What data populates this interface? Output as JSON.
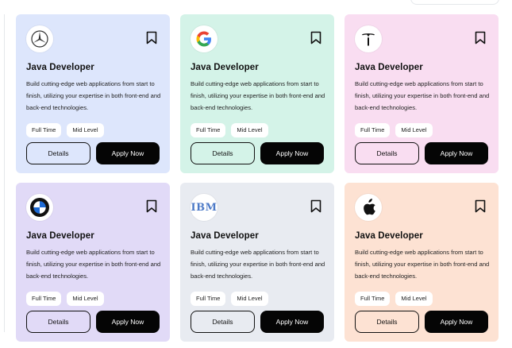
{
  "cards": [
    {
      "company_icon": "mercedes-logo",
      "title": "Java Developer",
      "description": "Build cutting-edge web applications from start to finish, utilizing your expertise in both front-end and back-end technologies.",
      "tags": [
        "Full Time",
        "Mid Level"
      ],
      "details_label": "Details",
      "apply_label": "Apply Now",
      "bg_color": "#dde6fc"
    },
    {
      "company_icon": "google-logo",
      "title": "Java Developer",
      "description": "Build cutting-edge web applications from start to finish, utilizing your expertise in both front-end and back-end technologies.",
      "tags": [
        "Full Time",
        "Mid Level"
      ],
      "details_label": "Details",
      "apply_label": "Apply Now",
      "bg_color": "#d4f3e8"
    },
    {
      "company_icon": "tesla-logo",
      "title": "Java Developer",
      "description": "Build cutting-edge web applications from start to finish, utilizing your expertise in both front-end and back-end technologies.",
      "tags": [
        "Full Time",
        "Mid Level"
      ],
      "details_label": "Details",
      "apply_label": "Apply Now",
      "bg_color": "#f9ddf1"
    },
    {
      "company_icon": "bmw-logo",
      "title": "Java Developer",
      "description": "Build cutting-edge web applications from start to finish, utilizing your expertise in both front-end and back-end technologies.",
      "tags": [
        "Full Time",
        "Mid Level"
      ],
      "details_label": "Details",
      "apply_label": "Apply Now",
      "bg_color": "#e1daf7"
    },
    {
      "company_icon": "ibm-logo",
      "logo_text": "IBM",
      "title": "Java Developer",
      "description": "Build cutting-edge web applications from start to finish, utilizing your expertise in both front-end and back-end technologies.",
      "tags": [
        "Full Time",
        "Mid Level"
      ],
      "details_label": "Details",
      "apply_label": "Apply Now",
      "bg_color": "#e8ebf1"
    },
    {
      "company_icon": "apple-logo",
      "title": "Java Developer",
      "description": "Build cutting-edge web applications from start to finish, utilizing your expertise in both front-end and back-end technologies.",
      "tags": [
        "Full Time",
        "Mid Level"
      ],
      "details_label": "Details",
      "apply_label": "Apply Now",
      "bg_color": "#fde2d3"
    }
  ],
  "colors": {
    "apply_button": "#050505",
    "tag_background": "#ffffff",
    "card_text": "#111111"
  }
}
